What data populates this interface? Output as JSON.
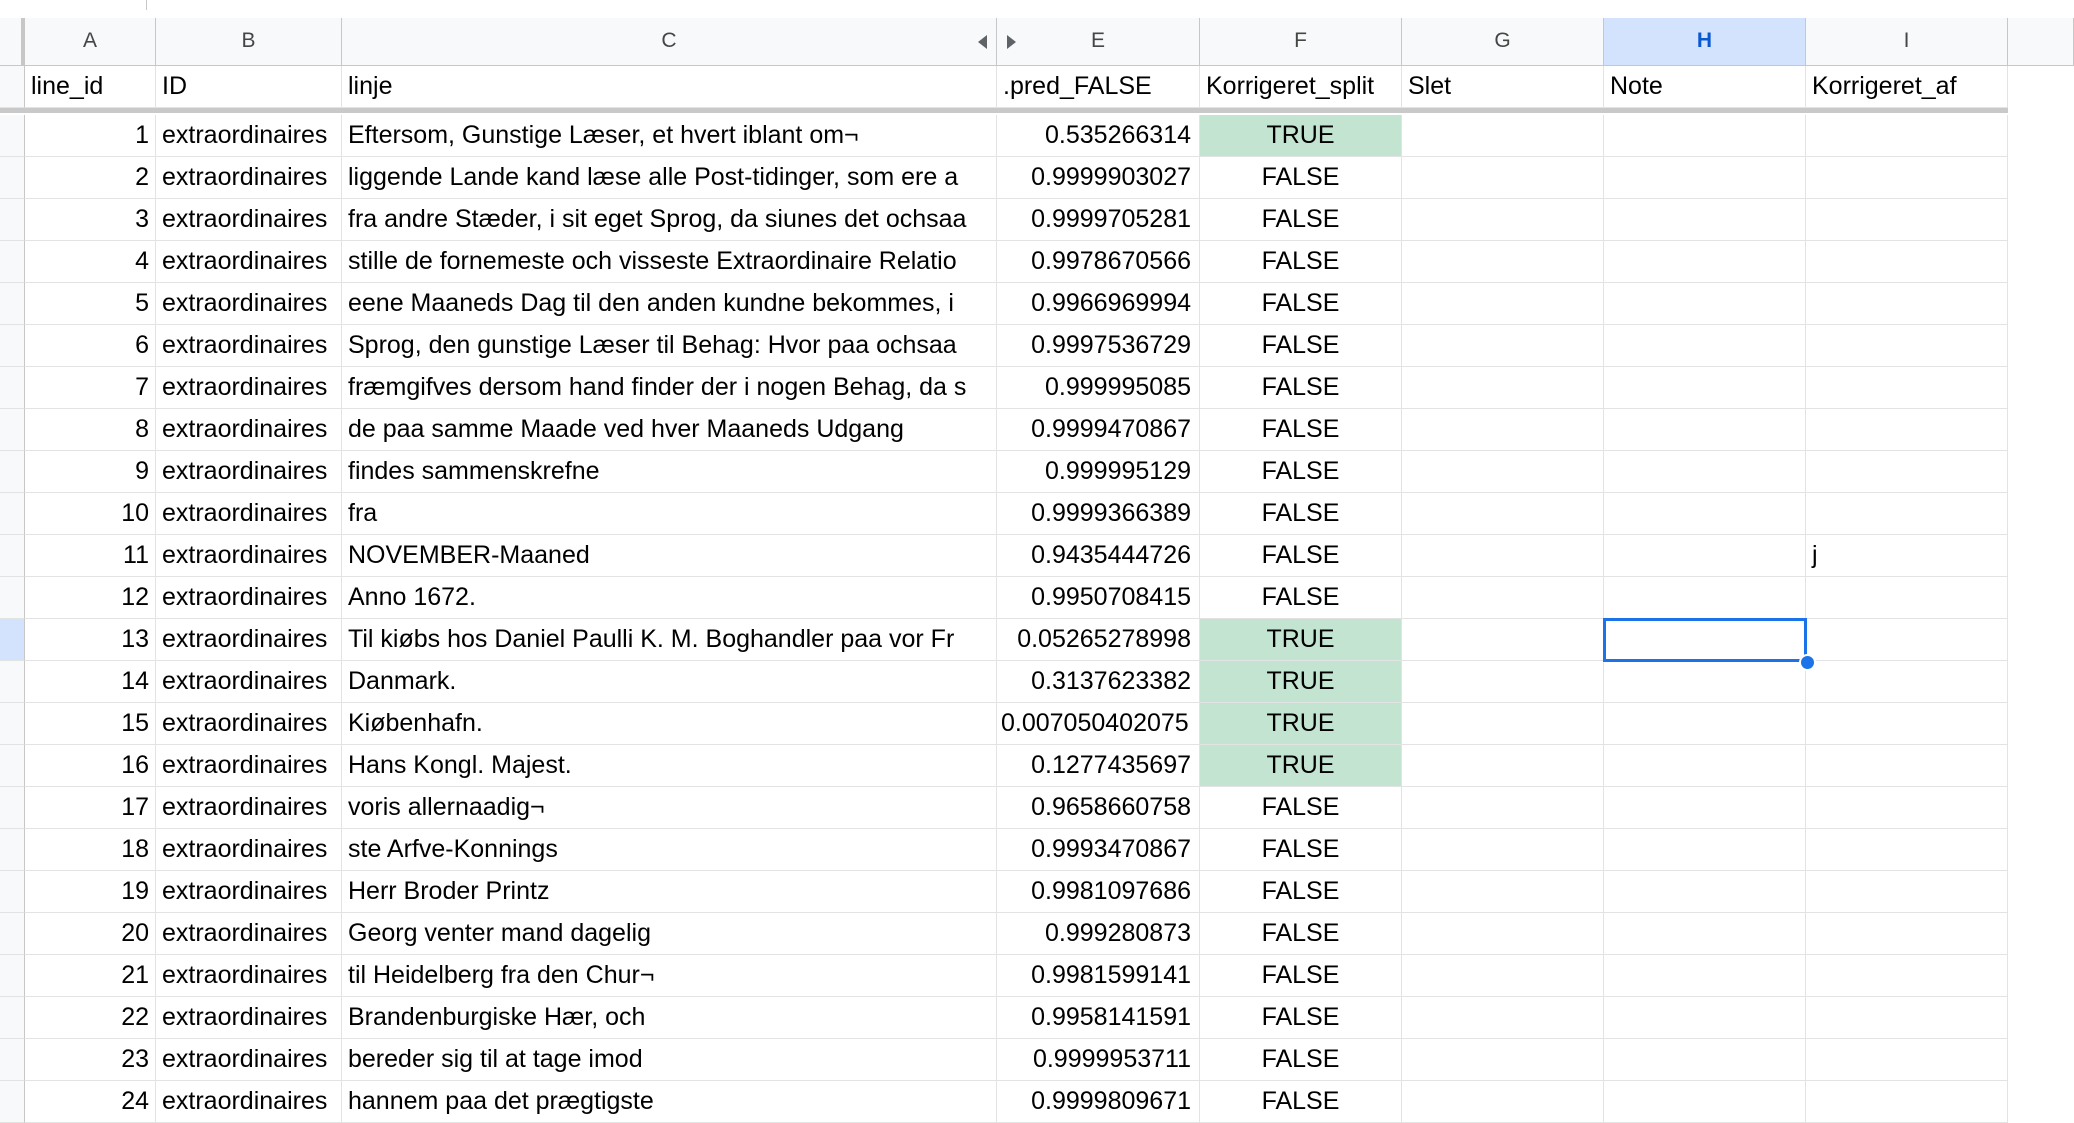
{
  "columns": [
    {
      "letter": "A",
      "header": "line_id"
    },
    {
      "letter": "B",
      "header": "ID"
    },
    {
      "letter": "C",
      "header": "linje"
    },
    {
      "letter": "E",
      "header": ".pred_FALSE"
    },
    {
      "letter": "F",
      "header": "Korrigeret_split"
    },
    {
      "letter": "G",
      "header": "Slet"
    },
    {
      "letter": "H",
      "header": "Note"
    },
    {
      "letter": "I",
      "header": "Korrigeret_af"
    }
  ],
  "active_column": "H",
  "rows": [
    {
      "line_id": "1",
      "id": "extraordinaires",
      "linje": "Eftersom, Gunstige Læser, et hvert iblant om¬",
      "pred": "0.535266314",
      "split": "TRUE",
      "note": "",
      "af": ""
    },
    {
      "line_id": "2",
      "id": "extraordinaires",
      "linje": "liggende Lande kand læse alle Post-tidinger, som ere a",
      "pred": "0.9999903027",
      "split": "FALSE",
      "note": "",
      "af": ""
    },
    {
      "line_id": "3",
      "id": "extraordinaires",
      "linje": "fra andre Stæder, i sit eget Sprog, da siunes det ochsaa",
      "pred": "0.9999705281",
      "split": "FALSE",
      "note": "",
      "af": ""
    },
    {
      "line_id": "4",
      "id": "extraordinaires",
      "linje": "stille de fornemeste och visseste Extraordinaire Relatio",
      "pred": "0.9978670566",
      "split": "FALSE",
      "note": "",
      "af": ""
    },
    {
      "line_id": "5",
      "id": "extraordinaires",
      "linje": "eene Maaneds Dag til den anden kundne bekommes, i",
      "pred": "0.9966969994",
      "split": "FALSE",
      "note": "",
      "af": ""
    },
    {
      "line_id": "6",
      "id": "extraordinaires",
      "linje": "Sprog, den gunstige Læser til Behag: Hvor paa ochsaa",
      "pred": "0.9997536729",
      "split": "FALSE",
      "note": "",
      "af": ""
    },
    {
      "line_id": "7",
      "id": "extraordinaires",
      "linje": "fræmgifves dersom hand finder der i nogen Behag, da s",
      "pred": "0.999995085",
      "split": "FALSE",
      "note": "",
      "af": ""
    },
    {
      "line_id": "8",
      "id": "extraordinaires",
      "linje": "de paa samme Maade ved hver Maaneds Udgang",
      "pred": "0.9999470867",
      "split": "FALSE",
      "note": "",
      "af": ""
    },
    {
      "line_id": "9",
      "id": "extraordinaires",
      "linje": "findes sammenskrefne",
      "pred": "0.999995129",
      "split": "FALSE",
      "note": "",
      "af": ""
    },
    {
      "line_id": "10",
      "id": "extraordinaires",
      "linje": "fra",
      "pred": "0.9999366389",
      "split": "FALSE",
      "note": "",
      "af": ""
    },
    {
      "line_id": "11",
      "id": "extraordinaires",
      "linje": "NOVEMBER-Maaned",
      "pred": "0.9435444726",
      "split": "FALSE",
      "note": "",
      "af": "j"
    },
    {
      "line_id": "12",
      "id": "extraordinaires",
      "linje": "Anno 1672.",
      "pred": "0.9950708415",
      "split": "FALSE",
      "note": "",
      "af": ""
    },
    {
      "line_id": "13",
      "id": "extraordinaires",
      "linje": "Til kiøbs hos Daniel Paulli K. M. Boghandler paa vor Fr",
      "pred": "0.05265278998",
      "split": "TRUE",
      "note": "",
      "af": ""
    },
    {
      "line_id": "14",
      "id": "extraordinaires",
      "linje": "Danmark.",
      "pred": "0.3137623382",
      "split": "TRUE",
      "note": "",
      "af": ""
    },
    {
      "line_id": "15",
      "id": "extraordinaires",
      "linje": "Kiøbenhafn.",
      "pred": "0.007050402075",
      "split": "TRUE",
      "note": "",
      "af": ""
    },
    {
      "line_id": "16",
      "id": "extraordinaires",
      "linje": "Hans Kongl. Majest.",
      "pred": "0.1277435697",
      "split": "TRUE",
      "note": "",
      "af": ""
    },
    {
      "line_id": "17",
      "id": "extraordinaires",
      "linje": "voris allernaadig¬",
      "pred": "0.9658660758",
      "split": "FALSE",
      "note": "",
      "af": ""
    },
    {
      "line_id": "18",
      "id": "extraordinaires",
      "linje": "ste Arfve-Konnings",
      "pred": "0.9993470867",
      "split": "FALSE",
      "note": "",
      "af": ""
    },
    {
      "line_id": "19",
      "id": "extraordinaires",
      "linje": "Herr Broder Printz",
      "pred": "0.9981097686",
      "split": "FALSE",
      "note": "",
      "af": ""
    },
    {
      "line_id": "20",
      "id": "extraordinaires",
      "linje": "Georg venter mand dagelig",
      "pred": "0.999280873",
      "split": "FALSE",
      "note": "",
      "af": ""
    },
    {
      "line_id": "21",
      "id": "extraordinaires",
      "linje": "til Heidelberg fra den Chur¬",
      "pred": "0.9981599141",
      "split": "FALSE",
      "note": "",
      "af": ""
    },
    {
      "line_id": "22",
      "id": "extraordinaires",
      "linje": "Brandenburgiske Hær, och",
      "pred": "0.9958141591",
      "split": "FALSE",
      "note": "",
      "af": ""
    },
    {
      "line_id": "23",
      "id": "extraordinaires",
      "linje": "bereder sig til at tage imod",
      "pred": "0.9999953711",
      "split": "FALSE",
      "note": "",
      "af": ""
    },
    {
      "line_id": "24",
      "id": "extraordinaires",
      "linje": "hannem paa det prægtigste",
      "pred": "0.9999809671",
      "split": "FALSE",
      "note": "",
      "af": ""
    }
  ],
  "selected_row": 13,
  "selected_column": "H",
  "colors": {
    "true_fill": "#c3e4d1",
    "selection": "#1a73e8",
    "header_bg": "#f8f9fa",
    "active_header_bg": "#d3e3fd"
  },
  "icons": {
    "hidden_column_left": "triangle-left-icon",
    "hidden_column_right": "triangle-right-icon"
  }
}
